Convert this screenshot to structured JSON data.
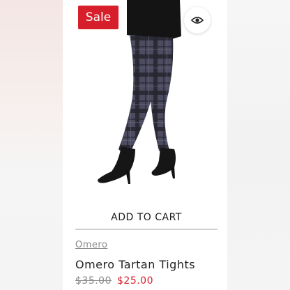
{
  "product": {
    "badge": "Sale",
    "quick_view_icon": "eye-icon",
    "add_to_cart_label": "ADD TO CART",
    "brand": "Omero",
    "title": "Omero Tartan Tights",
    "old_price": "$35.00",
    "new_price": "$25.00",
    "image_subject": "legs-in-tartan-tights-with-black-heeled-boots"
  },
  "colors": {
    "sale": "#d71f2b",
    "brand_text": "#8a8a8a",
    "title_text": "#222222",
    "tights_base": "#4a4a5e",
    "tartan_line": "#1b1b24"
  }
}
